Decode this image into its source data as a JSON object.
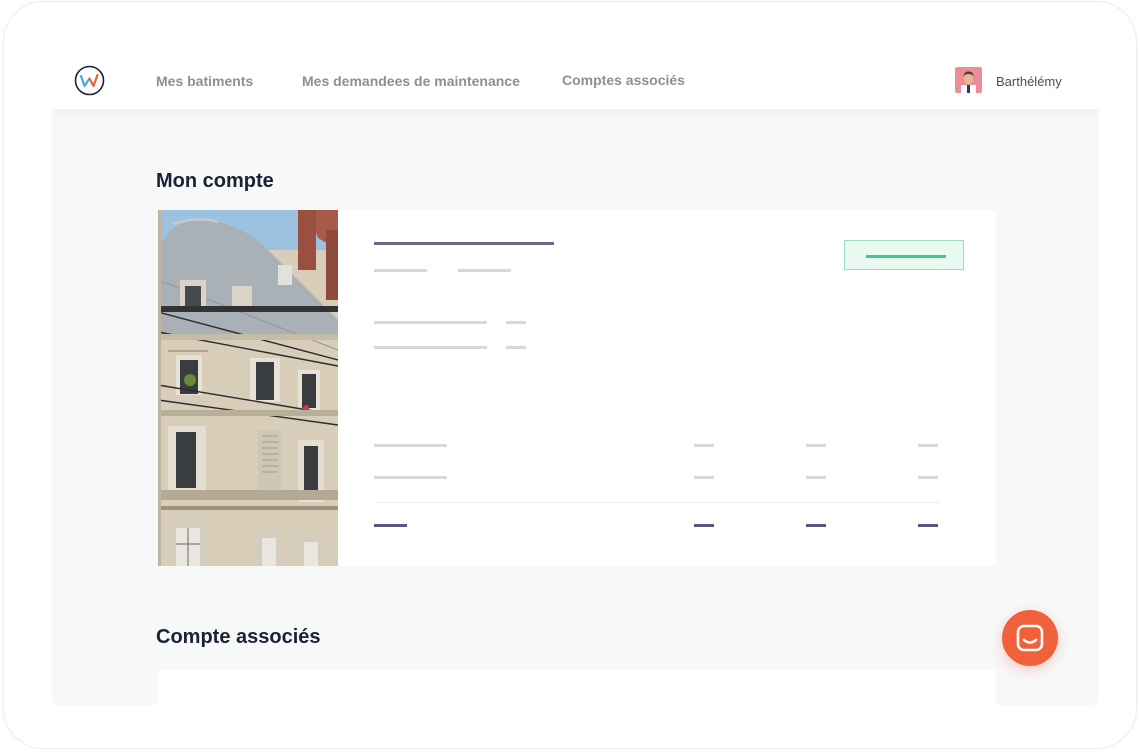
{
  "nav": {
    "links": [
      "Mes batiments",
      "Mes demandees de maintenance",
      "Comptes associés"
    ],
    "user_name": "Barthélémy"
  },
  "sections": {
    "account_title": "Mon compte",
    "associated_title": "Compte associés"
  },
  "icons": {
    "logo": "wm-logo-icon",
    "avatar": "user-avatar",
    "chat": "chat-icon"
  },
  "colors": {
    "chat_accent": "#f0603b",
    "status_green": "#46c48c",
    "text_primary": "#1c2133"
  }
}
